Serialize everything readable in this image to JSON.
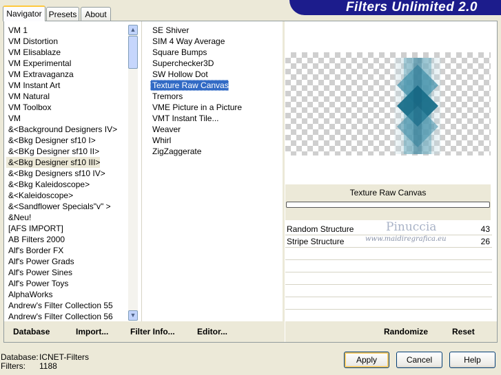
{
  "tabs": [
    {
      "label": "Navigator",
      "active": true
    },
    {
      "label": "Presets",
      "active": false
    },
    {
      "label": "About",
      "active": false
    }
  ],
  "banner": {
    "title": "Filters Unlimited 2.0"
  },
  "categories": [
    "VM 1",
    "VM Distortion",
    "VM Elisablaze",
    "VM Experimental",
    "VM Extravaganza",
    "VM Instant Art",
    "VM Natural",
    "VM Toolbox",
    "VM",
    "&<Background Designers IV>",
    "&<Bkg Designer sf10 I>",
    "&<BKg Designer sf10 II>",
    "&<Bkg Designer sf10 III>",
    "&<Bkg Designers sf10 IV>",
    "&<Bkg Kaleidoscope>",
    "&<Kaleidoscope>",
    "&<Sandflower Specials\"v\" >",
    "&Neu!",
    "[AFS IMPORT]",
    "AB Filters 2000",
    "Alf's Border FX",
    "Alf's Power Grads",
    "Alf's Power Sines",
    "Alf's Power Toys",
    "AlphaWorks",
    "Andrew's Filter Collection 55",
    "Andrew's Filter Collection 56"
  ],
  "selected_category": "&<Bkg Designer sf10 III>",
  "filters": [
    "SE Shiver",
    "SIM 4 Way Average",
    "Square Bumps",
    "Superchecker3D",
    "SW Hollow Dot",
    "Texture Raw Canvas",
    "Tremors",
    "VME Picture in a Picture",
    "VMT Instant Tile...",
    "Weaver",
    "Whirl",
    "ZigZaggerate"
  ],
  "selected_filter": "Texture Raw Canvas",
  "filter_name": "Texture Raw Canvas",
  "watermark": {
    "line1": "Pinuccia",
    "line2": "www.maidiregrafica.eu"
  },
  "params": [
    {
      "label": "Random Structure",
      "value": "43"
    },
    {
      "label": "Stripe Structure",
      "value": "26"
    }
  ],
  "bottom_left": {
    "database": "Database",
    "import": "Import...",
    "filter_info": "Filter Info...",
    "editor": "Editor..."
  },
  "bottom_right": {
    "randomize": "Randomize",
    "reset": "Reset"
  },
  "status": {
    "database_label": "Database:",
    "database_value": "ICNET-Filters",
    "filters_label": "Filters:",
    "filters_value": "1188"
  },
  "buttons": {
    "apply": "Apply",
    "cancel": "Cancel",
    "help": "Help"
  },
  "colors": {
    "banner": "#1c1c8c",
    "selection": "#316ac5",
    "preview_teal": "#1a6f8a"
  }
}
